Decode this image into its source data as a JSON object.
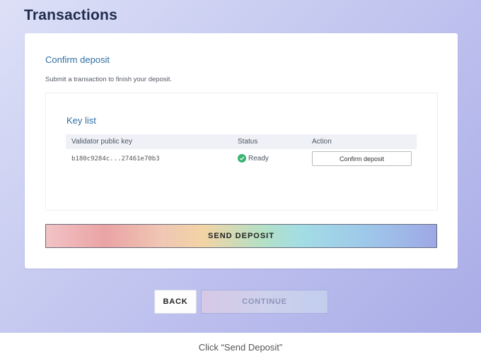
{
  "header": {
    "title": "Transactions"
  },
  "card": {
    "title": "Confirm deposit",
    "description": "Submit a transaction to finish your deposit."
  },
  "key_list": {
    "title": "Key list",
    "columns": [
      "Validator public key",
      "Status",
      "Action"
    ],
    "rows": [
      {
        "key": "b180c9284c...27461e70b3",
        "status": "Ready",
        "action": "Confirm deposit"
      }
    ]
  },
  "send_button": {
    "label": "SEND DEPOSIT"
  },
  "nav": {
    "back_label": "BACK",
    "continue_label": "CONTINUE"
  },
  "caption": "Click “Send Deposit”",
  "icons": {
    "status": "check-circle-icon"
  },
  "colors": {
    "status_ready": "#3bb273",
    "heading": "#2f6fa3"
  }
}
